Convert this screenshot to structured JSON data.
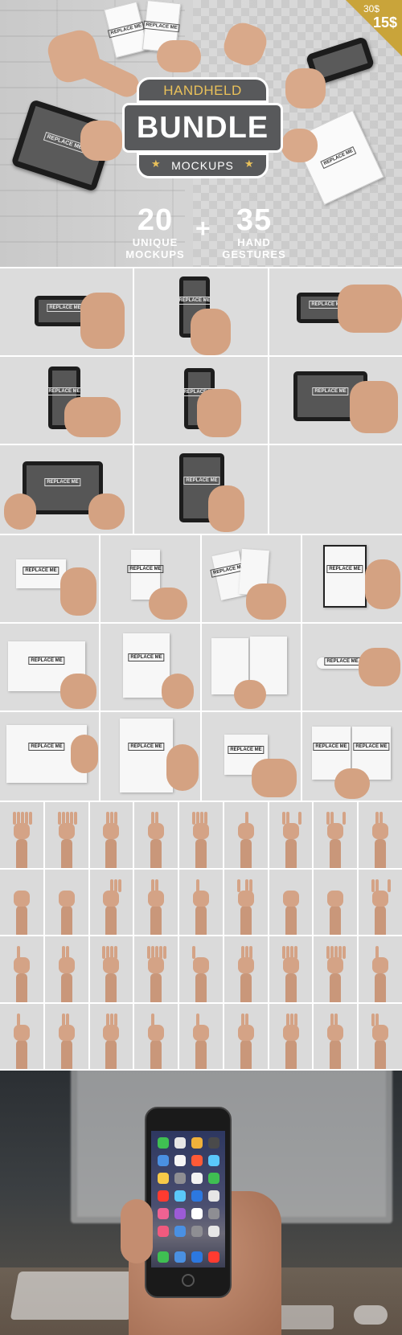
{
  "hero": {
    "badge_top": "HANDHELD",
    "badge_main": "BUNDLE",
    "badge_bottom": "MOCKUPS",
    "price_old": "30$",
    "price_new": "15$",
    "stat1_num": "20",
    "stat1_line1": "UNIQUE",
    "stat1_line2": "MOCKUPS",
    "plus": "+",
    "stat2_num": "35",
    "stat2_line1": "HAND",
    "stat2_line2": "GESTURES",
    "replace_label": "REPLACE ME",
    "accent_color": "#c9a43a",
    "badge_color": "#58595b"
  },
  "mockup_label": "REPLACE ME",
  "device_mockups_count": 8,
  "paper_mockups_count": 12,
  "gesture_count": 36
}
